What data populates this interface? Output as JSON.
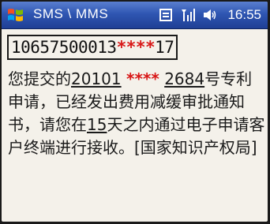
{
  "status_bar": {
    "title": "SMS \\ MMS",
    "time": "16:55",
    "icons": [
      "windows-start-icon",
      "connectivity-icon",
      "signal-icon",
      "speaker-icon"
    ]
  },
  "sender": {
    "prefix": "10657500013",
    "mask": "****",
    "suffix": "17"
  },
  "message": {
    "part1": "您提交的",
    "app_no_prefix": "20101",
    "app_no_mask": "****",
    "app_no_suffix": "2684",
    "part2": "号专利申请，已经发出费用减缓审批通知书，请您在",
    "days": "15",
    "part3": "天之内通过电子申请客户终端进行接收。[国家知识产权局]"
  },
  "colors": {
    "titlebar": "#2f56b2",
    "background": "#f4f1ea",
    "mask": "#d81818"
  }
}
